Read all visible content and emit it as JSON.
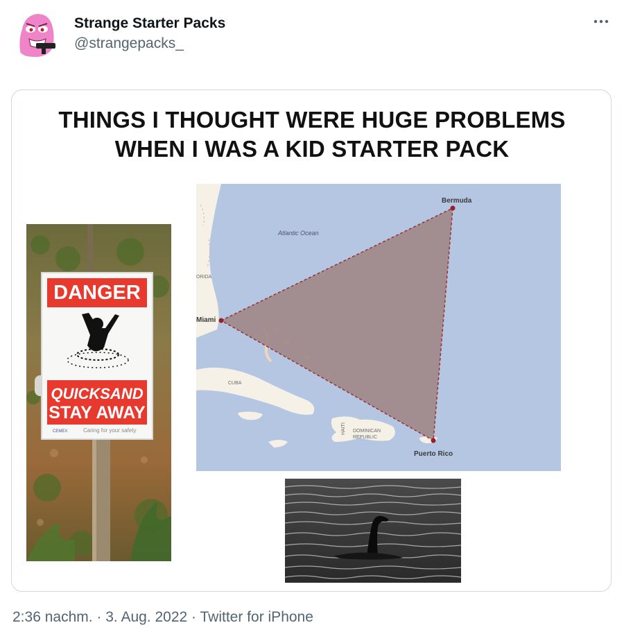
{
  "tweet": {
    "author": {
      "display_name": "Strange Starter Packs",
      "handle": "@strangepacks_"
    },
    "more_icon": "ellipsis-icon",
    "image": {
      "title_line1": "THINGS I THOUGHT WERE HUGE PROBLEMS",
      "title_line2": "WHEN I WAS A KID STARTER PACK",
      "sign": {
        "top": "DANGER",
        "bottom_line1": "QUICKSAND",
        "bottom_line2": "STAY AWAY",
        "footer": "Caring for your safety",
        "brand": "CEMEX"
      },
      "map": {
        "ocean": "Atlantic Ocean",
        "florida": "ORIDA",
        "cuba": "CUBA",
        "haiti": "HAITI",
        "dominican_1": "DOMINICAN",
        "dominican_2": "REPUBLIC",
        "bermuda": "Bermuda",
        "miami": "Miami",
        "puerto_rico": "Puerto Rico"
      }
    },
    "meta": {
      "time": "2:36 nachm.",
      "sep1": " · ",
      "date": "3. Aug. 2022",
      "sep2": " · ",
      "source": "Twitter for iPhone"
    },
    "colors": {
      "danger_red": "#e8392f",
      "map_ocean": "#b4c6e2",
      "triangle": "#a08788",
      "text_secondary": "#536471"
    }
  }
}
